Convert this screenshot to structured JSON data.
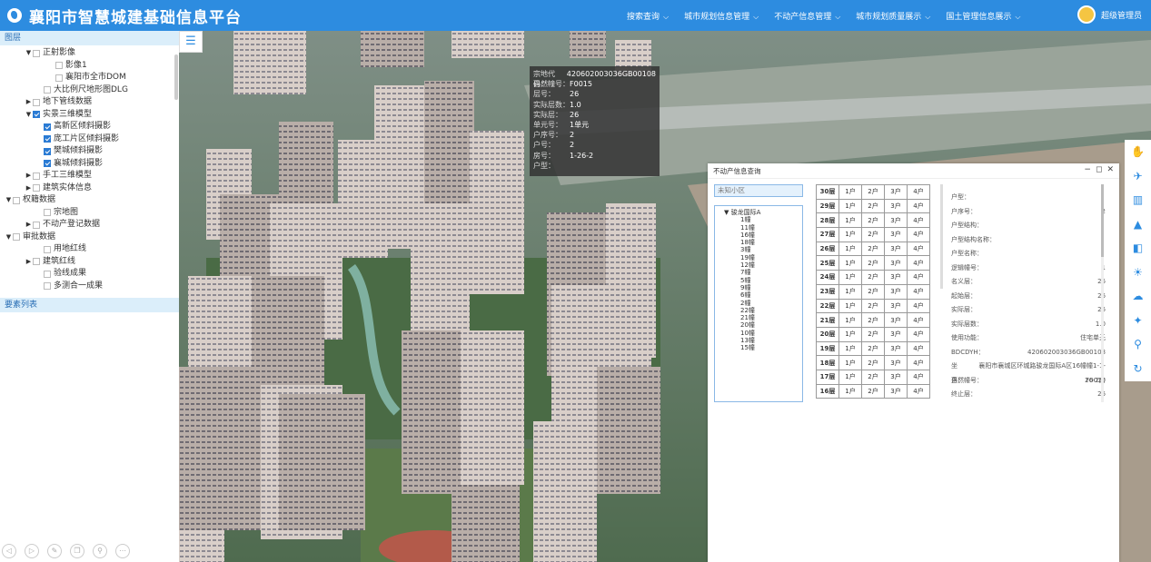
{
  "app": {
    "title": "襄阳市智慧城建基础信息平台",
    "nav": [
      "搜索查询",
      "城市规划信息管理",
      "不动产信息管理",
      "城市规划质量展示",
      "国土管理信息展示"
    ],
    "user": "超级管理员"
  },
  "left": {
    "layers_header": "图层",
    "features_header": "要素列表",
    "tree": [
      {
        "label": "正射影像",
        "level": 1,
        "toggle": "down",
        "check": false
      },
      {
        "label": "影像1",
        "level": 3,
        "toggle": "",
        "check": false
      },
      {
        "label": "襄阳市全市DOM",
        "level": 3,
        "toggle": "",
        "check": false
      },
      {
        "label": "大比例尺地形图DLG",
        "level": 2,
        "toggle": "",
        "check": false
      },
      {
        "label": "地下管线数据",
        "level": 1,
        "toggle": "right",
        "check": false
      },
      {
        "label": "实景三维模型",
        "level": 1,
        "toggle": "down",
        "check": true
      },
      {
        "label": "高新区倾斜摄影",
        "level": 2,
        "toggle": "",
        "check": true
      },
      {
        "label": "庞工片区倾斜摄影",
        "level": 2,
        "toggle": "",
        "check": true
      },
      {
        "label": "樊城倾斜摄影",
        "level": 2,
        "toggle": "",
        "check": true
      },
      {
        "label": "襄城倾斜摄影",
        "level": 2,
        "toggle": "",
        "check": true
      },
      {
        "label": "手工三维模型",
        "level": 1,
        "toggle": "right",
        "check": false
      },
      {
        "label": "建筑实体信息",
        "level": 1,
        "toggle": "right",
        "check": false
      },
      {
        "label": "权籍数据",
        "level": 0,
        "toggle": "down",
        "check": false
      },
      {
        "label": "宗地图",
        "level": 2,
        "toggle": "",
        "check": false
      },
      {
        "label": "不动产登记数据",
        "level": 1,
        "toggle": "right",
        "check": false
      },
      {
        "label": "审批数据",
        "level": 0,
        "toggle": "down",
        "check": false
      },
      {
        "label": "用地红线",
        "level": 2,
        "toggle": "",
        "check": false
      },
      {
        "label": "建筑红线",
        "level": 1,
        "toggle": "right",
        "check": false
      },
      {
        "label": "验线成果",
        "level": 2,
        "toggle": "",
        "check": false
      },
      {
        "label": "多测合一成果",
        "level": 2,
        "toggle": "",
        "check": false
      }
    ]
  },
  "popup": [
    {
      "k": "宗地代码：",
      "v": "420602003036GB00108"
    },
    {
      "k": "自然幢号：",
      "v": "F0015"
    },
    {
      "k": "层号：",
      "v": "26"
    },
    {
      "k": "实际层数：",
      "v": "1.0"
    },
    {
      "k": "实际层：",
      "v": "26"
    },
    {
      "k": "单元号：",
      "v": "1单元"
    },
    {
      "k": "户序号：",
      "v": "2"
    },
    {
      "k": "户号：",
      "v": "2"
    },
    {
      "k": "房号：",
      "v": "1-26-2"
    },
    {
      "k": "户型：",
      "v": ""
    }
  ],
  "dialog": {
    "title": "不动产信息查询",
    "search_placeholder": "未知小区",
    "root": "骏龙国际A",
    "units": [
      "1幢",
      "11幢",
      "16幢",
      "18幢",
      "3幢",
      "19幢",
      "12幢",
      "7幢",
      "5幢",
      "9幢",
      "6幢",
      "2幢",
      "22幢",
      "21幢",
      "20幢",
      "10幢",
      "13幢",
      "15幢"
    ],
    "floors": [
      "30层",
      "29层",
      "28层",
      "27层",
      "26层",
      "25层",
      "24层",
      "23层",
      "22层",
      "21层",
      "20层",
      "19层",
      "18层",
      "17层",
      "16层"
    ],
    "rooms": [
      "1户",
      "2户",
      "3户",
      "4户"
    ],
    "details": [
      {
        "k": "户型：",
        "v": ""
      },
      {
        "k": "户序号：",
        "v": "2"
      },
      {
        "k": "户型结构：",
        "v": ""
      },
      {
        "k": "户型结构名称：",
        "v": ""
      },
      {
        "k": "户型名称：",
        "v": ""
      },
      {
        "k": "逻辑幢号：",
        "v": "1"
      },
      {
        "k": "名义层：",
        "v": "26"
      },
      {
        "k": "起始层：",
        "v": "26"
      },
      {
        "k": "实际层：",
        "v": "26"
      },
      {
        "k": "实际层数：",
        "v": "1.0"
      },
      {
        "k": "使用功能：",
        "v": "住宅单元"
      },
      {
        "k": "BDCDYH：",
        "v": "420602003036GB00108"
      },
      {
        "k": "坐落：",
        "v": "襄阳市襄城区环城路骏龙国际A区16幢幢1-1-26-2房"
      },
      {
        "k": "自然幢号：",
        "v": "F0010"
      },
      {
        "k": "终止层：",
        "v": "26"
      }
    ]
  },
  "icons": {
    "right_toolbar": [
      "hand-icon",
      "plane-icon",
      "book-icon",
      "mountain-icon",
      "split-icon",
      "sun-icon",
      "cloud-icon",
      "satellite-icon",
      "location-icon",
      "refresh-icon"
    ],
    "bottom_tools": [
      "prev-icon",
      "next-icon",
      "edit-icon",
      "copy-icon",
      "search-icon",
      "more-icon"
    ]
  }
}
